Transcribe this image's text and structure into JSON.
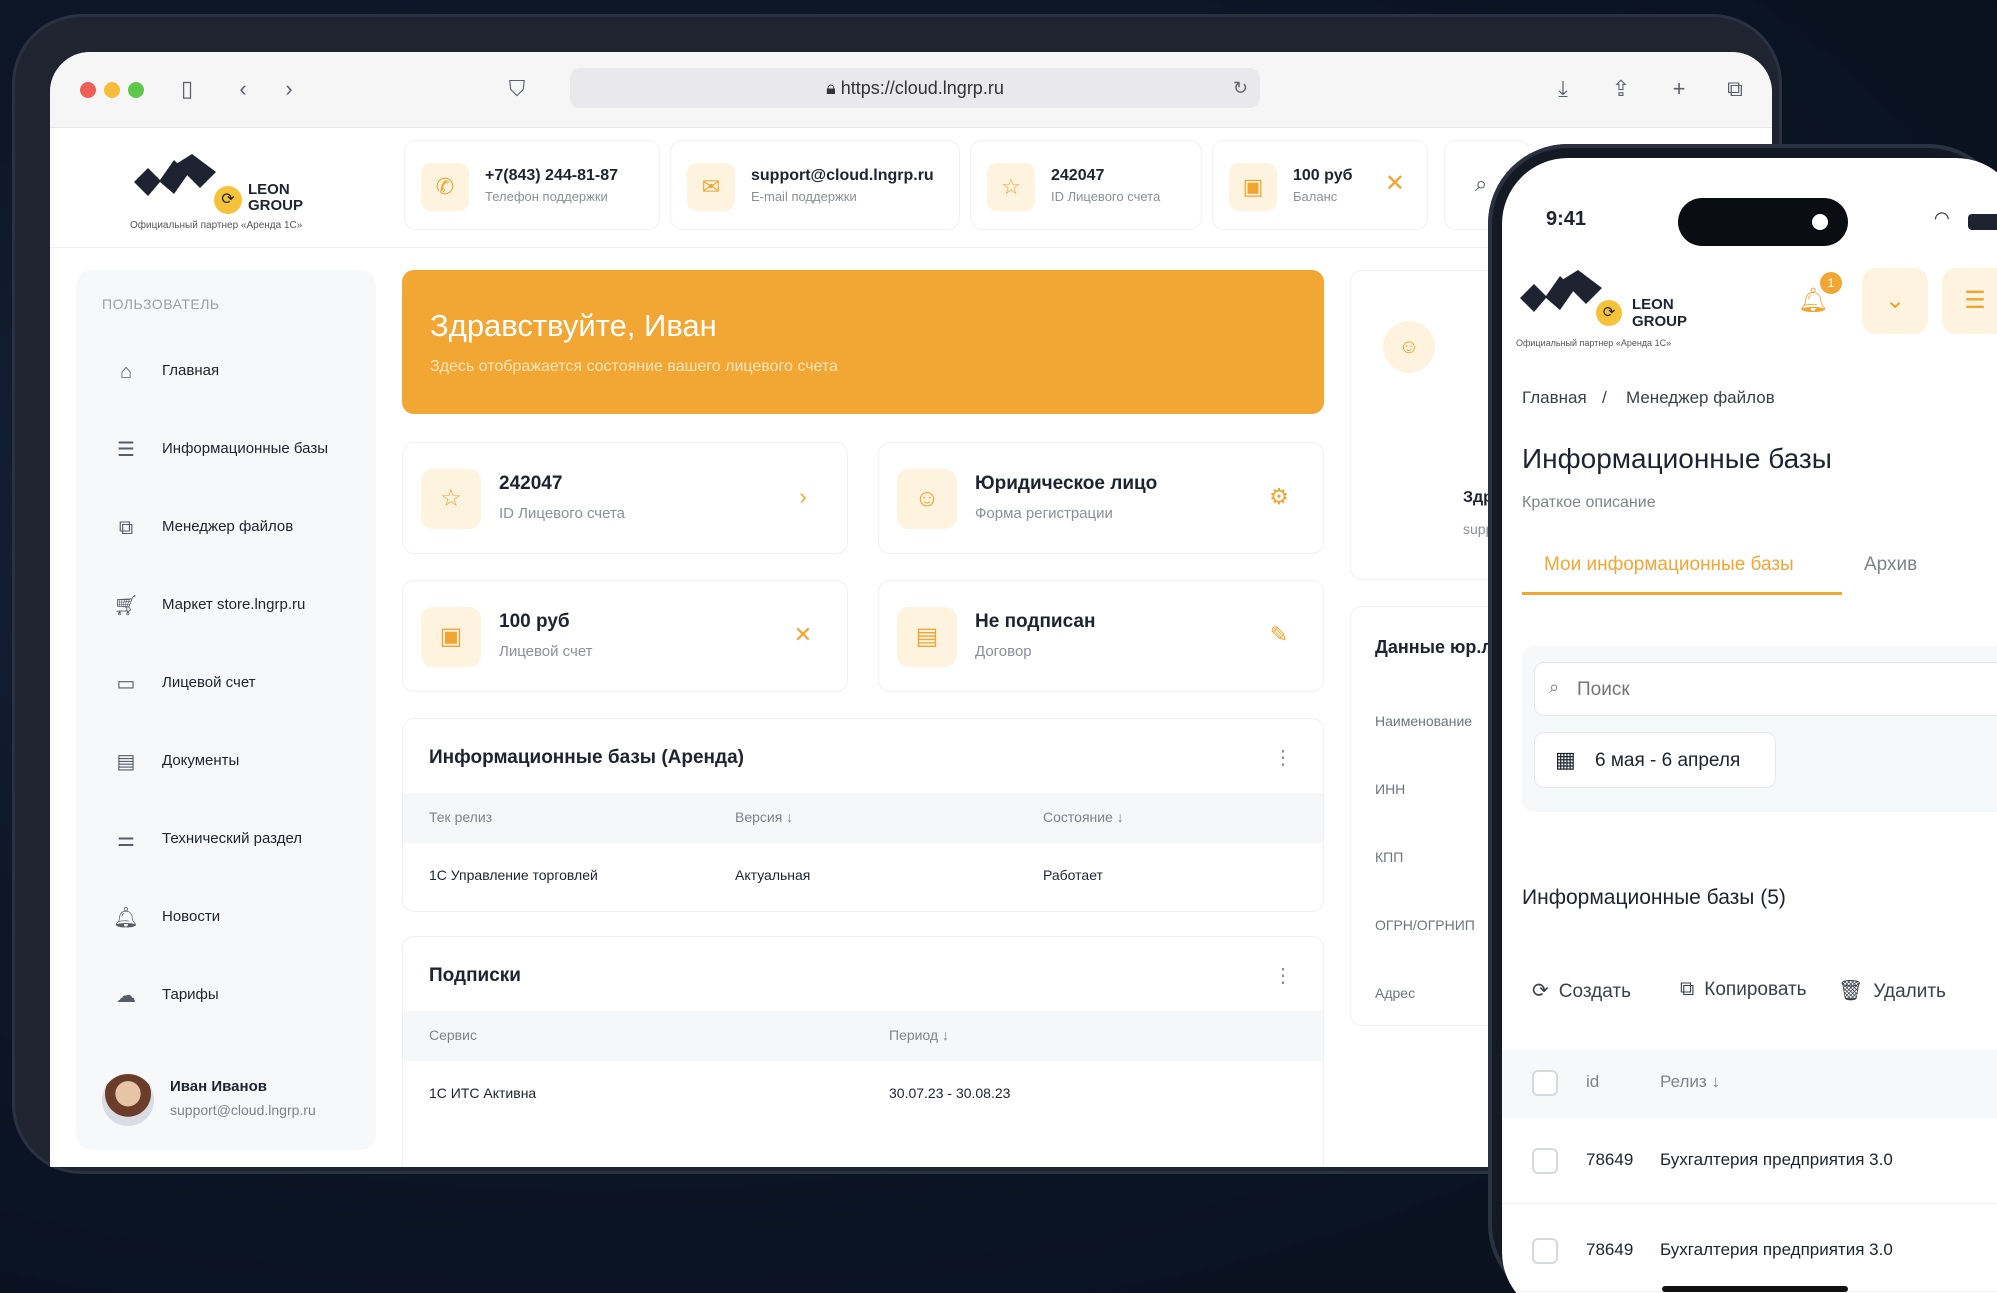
{
  "browser": {
    "url": "https://cloud.lngrp.ru"
  },
  "logo": {
    "name_line1": "LEON",
    "name_line2": "GROUP",
    "subtitle": "Официальный партнер «Аренда 1С»"
  },
  "header": {
    "phone": {
      "value": "+7(843) 244-81-87",
      "label": "Телефон поддержки"
    },
    "email": {
      "value": "support@cloud.lngrp.ru",
      "label": "E-mail поддержки"
    },
    "account": {
      "value": "242047",
      "label": "ID Лицевого счета"
    },
    "balance": {
      "value": "100 руб",
      "label": "Баланс"
    }
  },
  "sidebar": {
    "title": "ПОЛЬЗОВАТЕЛЬ",
    "items": [
      {
        "label": "Главная"
      },
      {
        "label": "Информационные базы"
      },
      {
        "label": "Менеджер файлов"
      },
      {
        "label": "Маркет store.lngrp.ru"
      },
      {
        "label": "Лицевой счет"
      },
      {
        "label": "Документы"
      },
      {
        "label": "Технический раздел"
      },
      {
        "label": "Новости"
      },
      {
        "label": "Тарифы"
      }
    ],
    "user": {
      "name": "Иван Иванов",
      "email": "support@cloud.lngrp.ru"
    }
  },
  "banner": {
    "title": "Здравствуйте, Иван",
    "subtitle": "Здесь отображается состояние вашего лицевого счета"
  },
  "cards": [
    {
      "value": "242047",
      "label": "ID Лицевого счета"
    },
    {
      "value": "Юридическое лицо",
      "label": "Форма регистрации"
    },
    {
      "value": "100 руб",
      "label": "Лицевой счет"
    },
    {
      "value": "Не подписан",
      "label": "Договор"
    }
  ],
  "infobases": {
    "title": "Информационные базы (Аренда)",
    "columns": [
      "Тек релиз",
      "Версия",
      "Состояние"
    ],
    "rows": [
      [
        "1С Управление торговлей",
        "Актуальная",
        "Работает"
      ]
    ]
  },
  "subscriptions": {
    "title": "Подписки",
    "columns": [
      "Сервис",
      "Период"
    ],
    "rows": [
      [
        "1С ИТС Активна",
        "30.07.23 - 30.08.23"
      ]
    ]
  },
  "right": {
    "greet": "Здра",
    "mail": "supp",
    "section_title": "Данные юр.л",
    "fields": [
      "Наименование",
      "ИНН",
      "КПП",
      "ОГРН/ОГРНИП",
      "Адрес"
    ]
  },
  "phone": {
    "time": "9:41",
    "notif_count": "1",
    "breadcrumb": [
      "Главная",
      "/",
      "Менеджер файлов"
    ],
    "title": "Информационные базы",
    "description": "Краткое описание",
    "tabs": [
      "Мои информационные базы",
      "Архив"
    ],
    "search_placeholder": "Поиск",
    "date_range": "6 мая - 6 апреля",
    "list_title": "Информационные базы (5)",
    "actions": [
      "Создать",
      "Копировать",
      "Удалить"
    ],
    "columns": [
      "id",
      "Релиз"
    ],
    "rows": [
      {
        "id": "78649",
        "release": "Бухгалтерия предприятия 3.0"
      },
      {
        "id": "78649",
        "release": "Бухгалтерия предприятия 3.0"
      }
    ]
  },
  "colors": {
    "accent": "#f2a634",
    "accent_light": "#fdf3df",
    "background": "#0b1422"
  }
}
